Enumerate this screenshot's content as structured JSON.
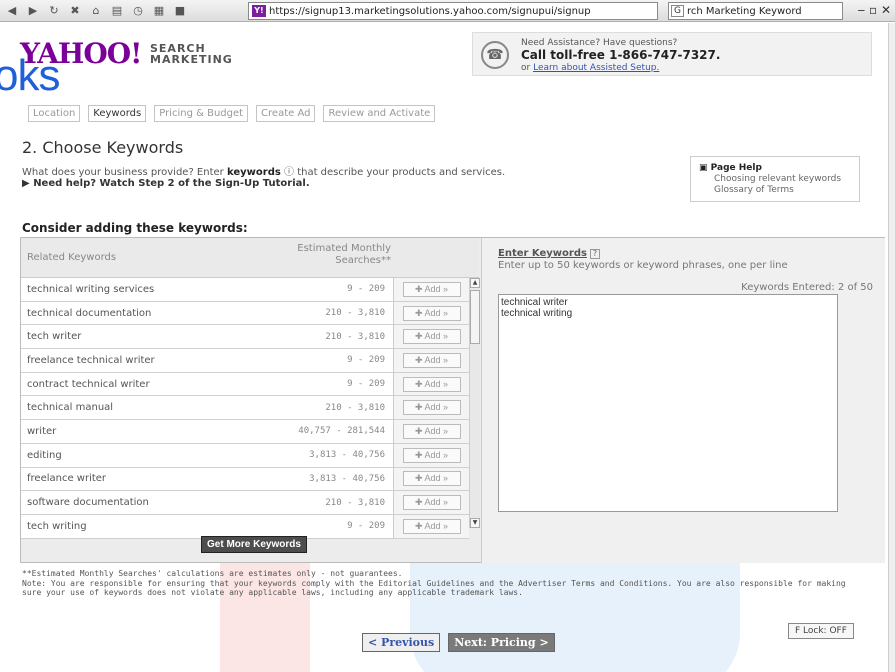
{
  "browser": {
    "url": "https://signup13.marketingsolutions.yahoo.com/signupui/signup",
    "url_favicon": "Y!",
    "search_value": "rch Marketing Keyword"
  },
  "brand": {
    "logo": "YAHOO!",
    "sub_line1": "SEARCH",
    "sub_line2": "MARKETING",
    "overlay": "oks"
  },
  "assist": {
    "line1": "Need Assistance? Have questions?",
    "line2": "Call toll-free 1-866-747-7327.",
    "line3_prefix": "or",
    "line3_link": "Learn about Assisted Setup."
  },
  "steps": [
    "Location",
    "Keywords",
    "Pricing & Budget",
    "Create Ad",
    "Review and Activate"
  ],
  "title": "2. Choose Keywords",
  "intro": {
    "text_a": "What does your business provide? Enter",
    "keyword": "keywords",
    "text_b": "that describe your products and services.",
    "tutorial": "Need help? Watch Step 2 of the Sign-Up Tutorial."
  },
  "pagehelp": {
    "title": "Page Help",
    "links": [
      "Choosing relevant keywords",
      "Glossary of Terms"
    ]
  },
  "consider": "Consider adding these keywords:",
  "table": {
    "col1": "Related Keywords",
    "col2a": "Estimated Monthly",
    "col2b": "Searches**",
    "add_label": "Add",
    "rows": [
      {
        "kw": "technical writing services",
        "searches": "9 - 209"
      },
      {
        "kw": "technical documentation",
        "searches": "210 - 3,810"
      },
      {
        "kw": "tech writer",
        "searches": "210 - 3,810"
      },
      {
        "kw": "freelance technical writer",
        "searches": "9 - 209"
      },
      {
        "kw": "contract technical writer",
        "searches": "9 - 209"
      },
      {
        "kw": "technical manual",
        "searches": "210 - 3,810"
      },
      {
        "kw": "writer",
        "searches": "40,757 - 281,544"
      },
      {
        "kw": "editing",
        "searches": "3,813 - 40,756"
      },
      {
        "kw": "freelance writer",
        "searches": "3,813 - 40,756"
      },
      {
        "kw": "software documentation",
        "searches": "210 - 3,810"
      },
      {
        "kw": "tech writing",
        "searches": "9 - 209"
      }
    ]
  },
  "getmore": "Get More Keywords",
  "enter": {
    "heading": "Enter Keywords",
    "sub": "Enter up to 50 keywords or keyword phrases, one per line",
    "count": "Keywords Entered: 2 of 50",
    "value": "technical writer\ntechnical writing"
  },
  "notes": {
    "l1": "**Estimated Monthly Searches' calculations are estimates only - not guarantees.",
    "l2": "Note: You are responsible for ensuring that your keywords comply with the Editorial Guidelines and the Advertiser Terms and Conditions. You are also responsible for making",
    "l3": "sure your use of keywords does not violate any applicable laws, including any applicable trademark laws."
  },
  "flock": "F Lock: OFF",
  "nav": {
    "prev": "< Previous",
    "next": "Next: Pricing >"
  }
}
